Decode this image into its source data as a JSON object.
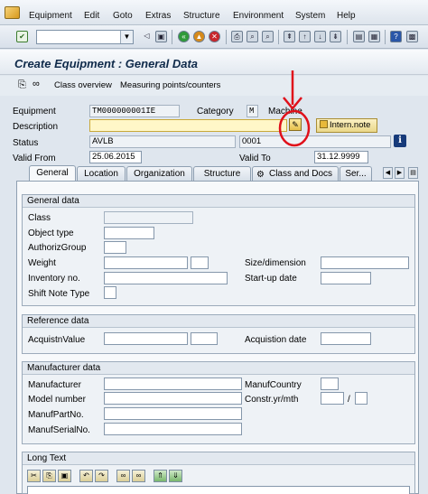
{
  "menu": [
    "Equipment",
    "Edit",
    "Goto",
    "Extras",
    "Structure",
    "Environment",
    "System",
    "Help"
  ],
  "page_title": "Create Equipment : General Data",
  "app_toolbar": {
    "class_overview": "Class overview",
    "measuring_points": "Measuring points/counters"
  },
  "header": {
    "equipment_label": "Equipment",
    "equipment_value": "TM000000001IE",
    "category_label": "Category",
    "category_value": "M",
    "category_text": "Machine",
    "description_label": "Description",
    "description_value": "",
    "intern_note": "Intern.note",
    "status_label": "Status",
    "status_value": "AVLB",
    "status_code": "0001",
    "valid_from_label": "Valid From",
    "valid_from_value": "25.06.2015",
    "valid_to_label": "Valid To",
    "valid_to_value": "31.12.9999"
  },
  "tabs": [
    "General",
    "Location",
    "Organization",
    "Structure",
    "Class and Docs",
    "Ser..."
  ],
  "general_data": {
    "title": "General data",
    "class": "Class",
    "object_type": "Object type",
    "authoriz_group": "AuthorizGroup",
    "weight": "Weight",
    "size_dimension": "Size/dimension",
    "inventory_no": "Inventory no.",
    "startup_date": "Start-up date",
    "shift_note_type": "Shift Note Type"
  },
  "reference_data": {
    "title": "Reference data",
    "acquistn_value": "AcquistnValue",
    "acquistion_date": "Acquistion date"
  },
  "manufacturer_data": {
    "title": "Manufacturer data",
    "manufacturer": "Manufacturer",
    "manuf_country": "ManufCountry",
    "model_number": "Model number",
    "constr_yr_mth": "Constr.yr/mth",
    "slash": "/",
    "manuf_part_no": "ManufPartNo.",
    "manuf_serial_no": "ManufSerialNo."
  },
  "long_text": {
    "title": "Long Text"
  },
  "colors": {
    "annotation": "#e0101a",
    "required_field": "#fff7c8",
    "title_text": "#0f2a4a"
  }
}
